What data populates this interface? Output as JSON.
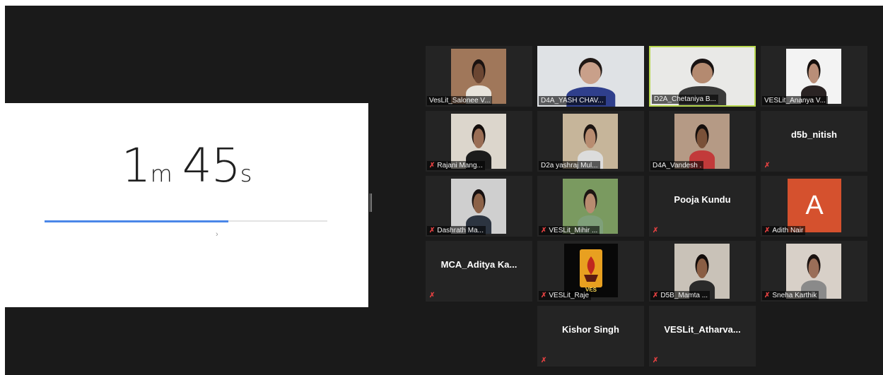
{
  "timer": {
    "minutes": "1",
    "minutes_unit": "m",
    "seconds": "45",
    "seconds_unit": "s",
    "progress": 0.65,
    "arrow_glyph": "›"
  },
  "colors": {
    "background": "#1a1a1a",
    "tile": "#242424",
    "speaking_border": "#b8d84f",
    "muted_icon": "#e04040",
    "progress_fill": "#4a86e8",
    "avatar_bg": "#d5512e"
  },
  "participants": [
    {
      "label": "VesLit_Salonee V...",
      "muted": false,
      "type": "video",
      "bg": "#a0775a",
      "skin": "#6b4632",
      "shirt": "#e8e4dc",
      "hair": "#1a1210"
    },
    {
      "label": "D4A_YASH CHAV...",
      "muted": false,
      "type": "video",
      "bg": "#dfe2e5",
      "skin": "#c9a08a",
      "shirt": "#2f3f8c",
      "hair": "#201815"
    },
    {
      "label": "D2A_Chetaniya B...",
      "muted": false,
      "type": "video",
      "speaking": true,
      "bg": "#e9e9e7",
      "skin": "#b48a70",
      "shirt": "#3a3a3a",
      "hair": "#181212"
    },
    {
      "label": "VESLit_Ananya V...",
      "muted": false,
      "type": "video",
      "bg": "#f3f3f3",
      "skin": "#b98e78",
      "shirt": "#2a2323",
      "hair": "#140e0c"
    },
    {
      "label": "Rajani Mang...",
      "muted": true,
      "type": "video",
      "bg": "#dcd6cc",
      "skin": "#9a6e55",
      "shirt": "#1c1c1c",
      "hair": "#140e0c"
    },
    {
      "label": "D2a yashraj Mul...",
      "muted": false,
      "type": "video",
      "bg": "#c6b59a",
      "skin": "#b88c70",
      "shirt": "#dcdcdc",
      "hair": "#1c1512"
    },
    {
      "label": "D4A_Vandesh .",
      "muted": false,
      "type": "video",
      "bg": "#b59a85",
      "skin": "#7a5138",
      "shirt": "#c23a3a",
      "hair": "#140e0c"
    },
    {
      "label": "d5b_nitish",
      "muted": true,
      "type": "name"
    },
    {
      "label": "Dashrath Ma...",
      "muted": true,
      "type": "video",
      "bg": "#cfcfcf",
      "skin": "#8c6248",
      "shirt": "#2c3440",
      "hair": "#161010"
    },
    {
      "label": "VESLit_Mihir ...",
      "muted": true,
      "type": "video",
      "bg": "#7a9a60",
      "skin": "#b88c70",
      "shirt": "#7fa07a",
      "hair": "#1c1512"
    },
    {
      "label": "Pooja Kundu",
      "muted": true,
      "type": "name"
    },
    {
      "label": "Adith Nair",
      "muted": true,
      "type": "avatar",
      "initial": "A"
    },
    {
      "label": "MCA_Aditya Ka...",
      "muted": true,
      "type": "name"
    },
    {
      "label": "VESLit_Raje",
      "muted": true,
      "type": "logo",
      "logo_text": "VES"
    },
    {
      "label": "D5B_Mamta ...",
      "muted": true,
      "type": "video",
      "bg": "#c9c2b8",
      "skin": "#8a5e44",
      "shirt": "#2a2a2a",
      "hair": "#120c0a"
    },
    {
      "label": "Sneha Karthik",
      "muted": true,
      "type": "video",
      "bg": "#d8d0c8",
      "skin": "#9a6e58",
      "shirt": "#8a8a8a",
      "hair": "#1a1210"
    },
    {
      "label": "Kishor Singh",
      "muted": true,
      "type": "name"
    },
    {
      "label": "VESLit_Atharva...",
      "muted": true,
      "type": "name"
    }
  ]
}
